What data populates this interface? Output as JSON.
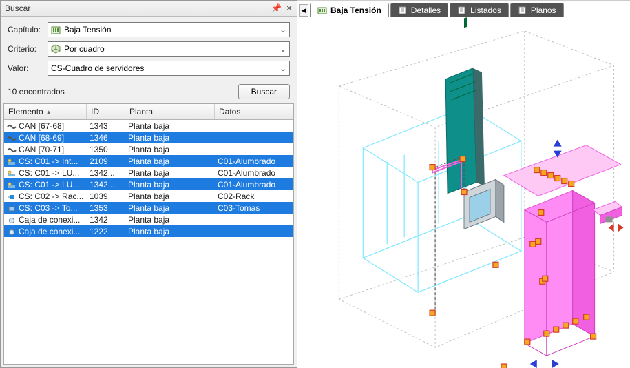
{
  "panel": {
    "title": "Buscar",
    "form": {
      "capitulo_label": "Capítulo:",
      "capitulo_value": "Baja Tensión",
      "criterio_label": "Criterio:",
      "criterio_value": "Por cuadro",
      "valor_label": "Valor:",
      "valor_value": "CS-Cuadro de servidores"
    },
    "status": "10 encontrados",
    "search_btn": "Buscar"
  },
  "table": {
    "headers": {
      "elemento": "Elemento",
      "id": "ID",
      "planta": "Planta",
      "datos": "Datos"
    },
    "rows": [
      {
        "icon": "can",
        "elemento": "CAN [67-68]",
        "id": "1343",
        "planta": "Planta baja",
        "datos": "",
        "selected": false
      },
      {
        "icon": "can",
        "elemento": "CAN [68-69]",
        "id": "1346",
        "planta": "Planta baja",
        "datos": "",
        "selected": true
      },
      {
        "icon": "can",
        "elemento": "CAN [70-71]",
        "id": "1350",
        "planta": "Planta baja",
        "datos": "",
        "selected": false
      },
      {
        "icon": "cs",
        "elemento": "CS: C01 -> Int...",
        "id": "2109",
        "planta": "Planta baja",
        "datos": "C01-Alumbrado",
        "selected": true
      },
      {
        "icon": "cs",
        "elemento": "CS: C01 -> LU...",
        "id": "1342...",
        "planta": "Planta baja",
        "datos": "C01-Alumbrado",
        "selected": false
      },
      {
        "icon": "cs",
        "elemento": "CS: C01 -> LU...",
        "id": "1342...",
        "planta": "Planta baja",
        "datos": "C01-Alumbrado",
        "selected": true
      },
      {
        "icon": "plug",
        "elemento": "CS: C02 -> Rac...",
        "id": "1039",
        "planta": "Planta baja",
        "datos": "C02-Rack",
        "selected": false
      },
      {
        "icon": "box",
        "elemento": "CS: C03 -> To...",
        "id": "1353",
        "planta": "Planta baja",
        "datos": "C03-Tomas",
        "selected": true
      },
      {
        "icon": "node",
        "elemento": "Caja de conexi...",
        "id": "1342",
        "planta": "Planta baja",
        "datos": "",
        "selected": false
      },
      {
        "icon": "node",
        "elemento": "Caja de conexi...",
        "id": "1222",
        "planta": "Planta baja",
        "datos": "",
        "selected": true
      }
    ]
  },
  "tabs": {
    "items": [
      {
        "label": "Baja Tensión",
        "active": true,
        "icon": "panel"
      },
      {
        "label": "Detalles",
        "active": false,
        "icon": "doc"
      },
      {
        "label": "Listados",
        "active": false,
        "icon": "doc"
      },
      {
        "label": "Planos",
        "active": false,
        "icon": "doc"
      }
    ]
  },
  "colors": {
    "selection": "#1e7be0",
    "cyan_wire": "#7fe8ff",
    "magenta": "#ff8cf4",
    "magenta_dark": "#f060e0",
    "teal": "#0e8f8a",
    "duct_dark": "#3a6a6a",
    "orange": "#f5a623",
    "red": "#d43a2a",
    "blue_arrow": "#2a3fd4"
  }
}
